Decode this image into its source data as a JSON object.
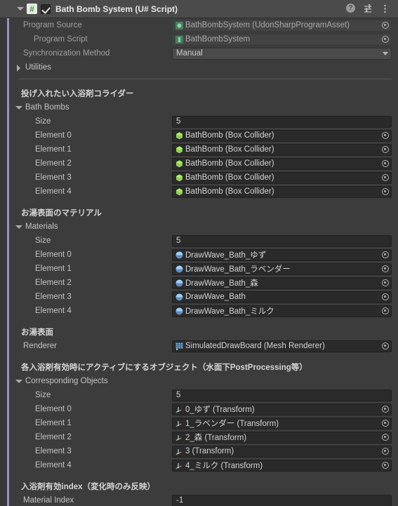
{
  "header": {
    "title": "Bath Bomb System (U# Script)",
    "script_icon": "csharp-script-icon",
    "enabled": true,
    "help_label": "?",
    "icons": [
      "help-icon",
      "preset-icon",
      "kebab-menu-icon"
    ]
  },
  "top_fields": [
    {
      "label": "Program Source",
      "value": "BathBombSystem (UdonSharpProgramAsset)",
      "icon": "udon-program-asset-icon",
      "type": "object",
      "disabled": true
    },
    {
      "label": "Program Script",
      "value": "BathBombSystem",
      "icon": "script-asset-icon",
      "type": "object",
      "disabled": true
    },
    {
      "label": "Synchronization Method",
      "value": "Manual",
      "type": "dropdown"
    }
  ],
  "utilities": {
    "label": "Utilities",
    "expanded": false
  },
  "sections": [
    {
      "help_text": "投げ入れたい入浴剤コライダー",
      "array_label": "Bath Bombs",
      "size_label": "Size",
      "size_value": "5",
      "icon": "box-collider-icon",
      "elements": [
        {
          "label": "Element 0",
          "value": "BathBomb (Box Collider)"
        },
        {
          "label": "Element 1",
          "value": "BathBomb (Box Collider)"
        },
        {
          "label": "Element 2",
          "value": "BathBomb (Box Collider)"
        },
        {
          "label": "Element 3",
          "value": "BathBomb (Box Collider)"
        },
        {
          "label": "Element 4",
          "value": "BathBomb (Box Collider)"
        }
      ]
    },
    {
      "help_text": "お湯表面のマテリアル",
      "array_label": "Materials",
      "size_label": "Size",
      "size_value": "5",
      "icon": "material-icon",
      "elements": [
        {
          "label": "Element 0",
          "value": "DrawWave_Bath_ゆず"
        },
        {
          "label": "Element 1",
          "value": "DrawWave_Bath_ラベンダー"
        },
        {
          "label": "Element 2",
          "value": "DrawWave_Bath_森"
        },
        {
          "label": "Element 3",
          "value": "DrawWave_Bath"
        },
        {
          "label": "Element 4",
          "value": "DrawWave_Bath_ミルク"
        }
      ]
    }
  ],
  "renderer_section": {
    "help_text": "お湯表面",
    "label": "Renderer",
    "value": "SimulatedDrawBoard (Mesh Renderer)",
    "icon": "mesh-renderer-icon"
  },
  "corresponding_section": {
    "help_text": "各入浴剤有効時にアクティブにするオブジェクト（水面下PostProcessing等）",
    "array_label": "Corresponding Objects",
    "size_label": "Size",
    "size_value": "5",
    "icon": "transform-icon",
    "elements": [
      {
        "label": "Element 0",
        "value": "0_ゆず (Transform)"
      },
      {
        "label": "Element 1",
        "value": "1_ラベンダー (Transform)"
      },
      {
        "label": "Element 2",
        "value": "2_森 (Transform)"
      },
      {
        "label": "Element 3",
        "value": "3 (Transform)"
      },
      {
        "label": "Element 4",
        "value": "4_ミルク (Transform)"
      }
    ]
  },
  "material_index_section": {
    "help_text": "入浴剤有効index（変化時のみ反映）",
    "label": "Material Index",
    "value": "-1"
  },
  "colors": {
    "accent": "#9a8fc4",
    "panel_bg": "#3c3c3c",
    "header_bg": "#4b4b4b",
    "field_bg": "#2a2a2a",
    "text": "#c4c4c4"
  }
}
